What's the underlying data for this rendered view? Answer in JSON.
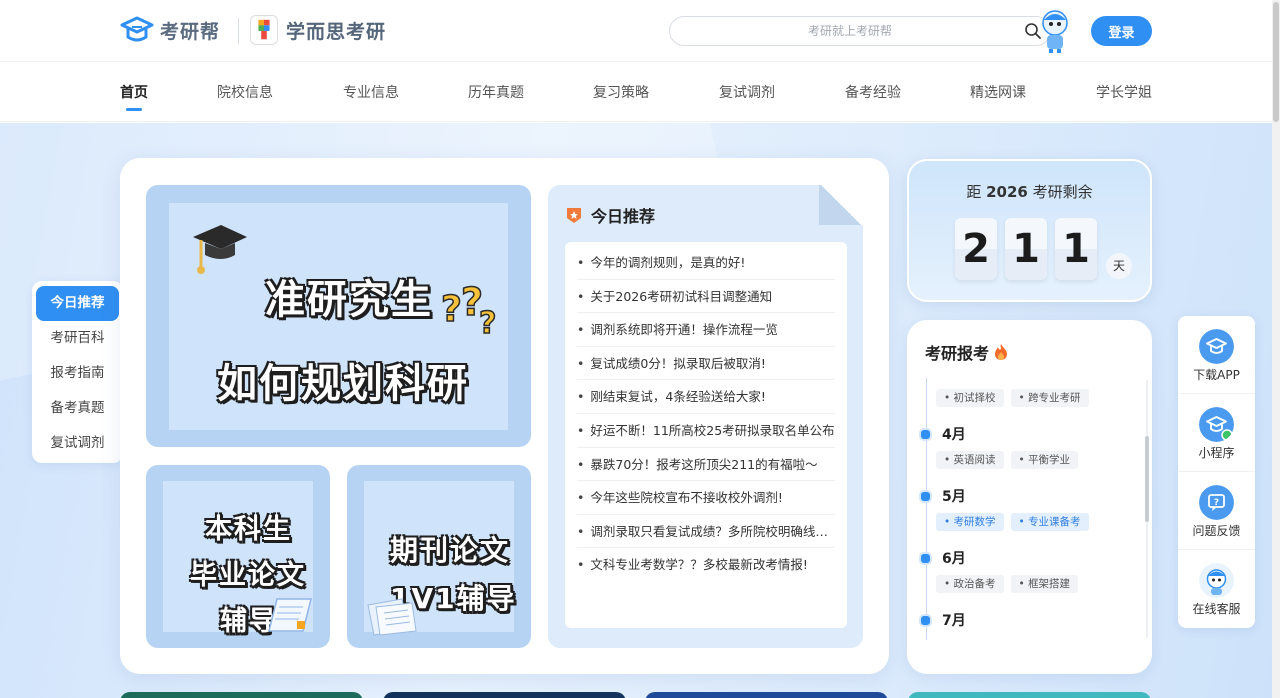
{
  "header": {
    "logo1_text": "考研帮",
    "logo2_text": "学而思考研",
    "search_placeholder": "考研就上考研帮",
    "login_label": "登录"
  },
  "nav": {
    "items": [
      "首页",
      "院校信息",
      "专业信息",
      "历年真题",
      "复习策略",
      "复试调剂",
      "备考经验",
      "精选网课",
      "学长学姐"
    ],
    "active": "首页"
  },
  "side_menu": {
    "items": [
      "今日推荐",
      "考研百科",
      "报考指南",
      "备考真题",
      "复试调剂"
    ],
    "active": "今日推荐"
  },
  "banners": {
    "big": {
      "line1": "准研究生",
      "line2": "如何规划科研"
    },
    "small1": {
      "line1": "本科生",
      "line2": "毕业论文",
      "line3": "辅导"
    },
    "small2": {
      "line1": "期刊论文",
      "line2": "1V1辅导"
    }
  },
  "recommend": {
    "title": "今日推荐",
    "items": [
      "今年的调剂规则，是真的好!",
      "关于2026考研初试科目调整通知",
      "调剂系统即将开通！操作流程一览",
      "复试成绩0分！拟录取后被取消!",
      "刚结束复试，4条经验送给大家!",
      "好运不断！11所高校25考研拟录取名单公布",
      "暴跌70分！报考这所顶尖211的有福啦～",
      "今年这些院校宣布不接收校外调剂!",
      "调剂录取只看复试成绩？多所院校明确线上复试",
      "文科专业考数学？？多校最新改考情报!"
    ]
  },
  "countdown": {
    "prefix": "距",
    "year": "2026",
    "suffix": "考研剩余",
    "digits": [
      "2",
      "1",
      "1"
    ],
    "unit": "天"
  },
  "timeline": {
    "title": "考研报考",
    "top_tags": [
      "初试择校",
      "跨专业考研"
    ],
    "months": [
      {
        "label": "4月",
        "tags": [
          {
            "text": "英语阅读",
            "hl": false
          },
          {
            "text": "平衡学业",
            "hl": false
          }
        ]
      },
      {
        "label": "5月",
        "tags": [
          {
            "text": "考研数学",
            "hl": true
          },
          {
            "text": "专业课备考",
            "hl": true
          }
        ]
      },
      {
        "label": "6月",
        "tags": [
          {
            "text": "政治备考",
            "hl": false
          },
          {
            "text": "框架搭建",
            "hl": false
          }
        ]
      },
      {
        "label": "7月",
        "tags": []
      }
    ]
  },
  "float_panel": {
    "items": [
      "下载APP",
      "小程序",
      "问题反馈",
      "在线客服"
    ]
  },
  "colors": {
    "accent": "#2f8ff2",
    "bottom_cards": [
      "#1d6b5a",
      "#13325c",
      "#1f4a9a",
      "#3fb9bd"
    ]
  }
}
